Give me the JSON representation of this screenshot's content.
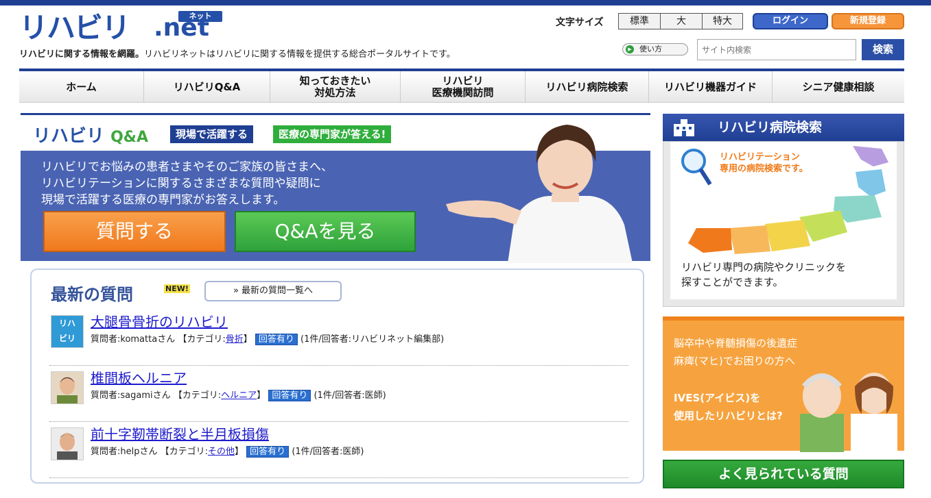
{
  "header": {
    "logo_text": "リハビリ",
    "logo_net": ".net",
    "logo_kana": "ネット",
    "tagline_bold": "リハビリに関する情報を網羅。",
    "tagline_rest": "リハビリネットはリハビリに関する情報を提供する総合ポータルサイトです。",
    "font_size_label": "文字サイズ",
    "font_sizes": [
      "標準",
      "大",
      "特大"
    ],
    "login_label": "ログイン",
    "signup_label": "新規登録",
    "howto_label": "使い方",
    "search_placeholder": "サイト内検索",
    "search_button": "検索"
  },
  "nav": [
    {
      "label": "ホーム"
    },
    {
      "label": "リハビリQ&A"
    },
    {
      "label": "知っておきたい\n対処方法"
    },
    {
      "label": "リハビリ\n医療機関訪問"
    },
    {
      "label": "リハビリ病院検索"
    },
    {
      "label": "リハビリ機器ガイド"
    },
    {
      "label": "シニア健康相談"
    }
  ],
  "hero": {
    "logo_main": "リハビリ",
    "logo_qa": "Q&A",
    "pill1": "現場で活躍する",
    "pill2": "医療の専門家が答える!",
    "text_lines": [
      "リハビリでお悩みの患者さまやそのご家族の皆さまへ、",
      "リハビリテーションに関するさまざまな質問や疑問に",
      "現場で活躍する医療の専門家がお答えします。"
    ],
    "ask_button": "質問する",
    "see_button": "Q&Aを見る"
  },
  "latest": {
    "title": "最新の質問",
    "new_badge": "NEW!",
    "list_link": "» 最新の質問一覧へ",
    "questions": [
      {
        "title": "大腿骨骨折のリハビリ",
        "asker_prefix": "質問者:komattaさん 【カテゴリ:",
        "category": "骨折",
        "category_suffix": "】",
        "status": "回答有り",
        "answer_info": "(1件/回答者:リハビリネット編集部)"
      },
      {
        "title": "椎間板ヘルニア",
        "asker_prefix": "質問者:sagamiさん 【カテゴリ:",
        "category": "ヘルニア",
        "category_suffix": "】",
        "status": "回答有り",
        "answer_info": "(1件/回答者:医師)"
      },
      {
        "title": "前十字靭帯断裂と半月板損傷",
        "asker_prefix": "質問者:helpさん 【カテゴリ:",
        "category": "その他",
        "category_suffix": "】",
        "status": "回答有り",
        "answer_info": "(1件/回答者:医師)"
      }
    ]
  },
  "sidebar": {
    "hospital_title": "リハビリ病院検索",
    "map_caption_1": "リハビリテーション",
    "map_caption_2": "専用の病院検索です。",
    "map_text_1": "リハビリ専門の病院やクリニックを",
    "map_text_2": "探すことができます。",
    "ives_line1": "脳卒中や脊髄損傷の後遺症",
    "ives_line2": "麻痺(マヒ)でお困りの方へ",
    "ives_line3": "IVES(アイビス)を",
    "ives_line4": "使用したリハビリとは?",
    "popular_title": "よく見られている質問"
  },
  "colors": {
    "brand_blue": "#1f3f93",
    "orange": "#f0791c",
    "green": "#2ea23a"
  }
}
